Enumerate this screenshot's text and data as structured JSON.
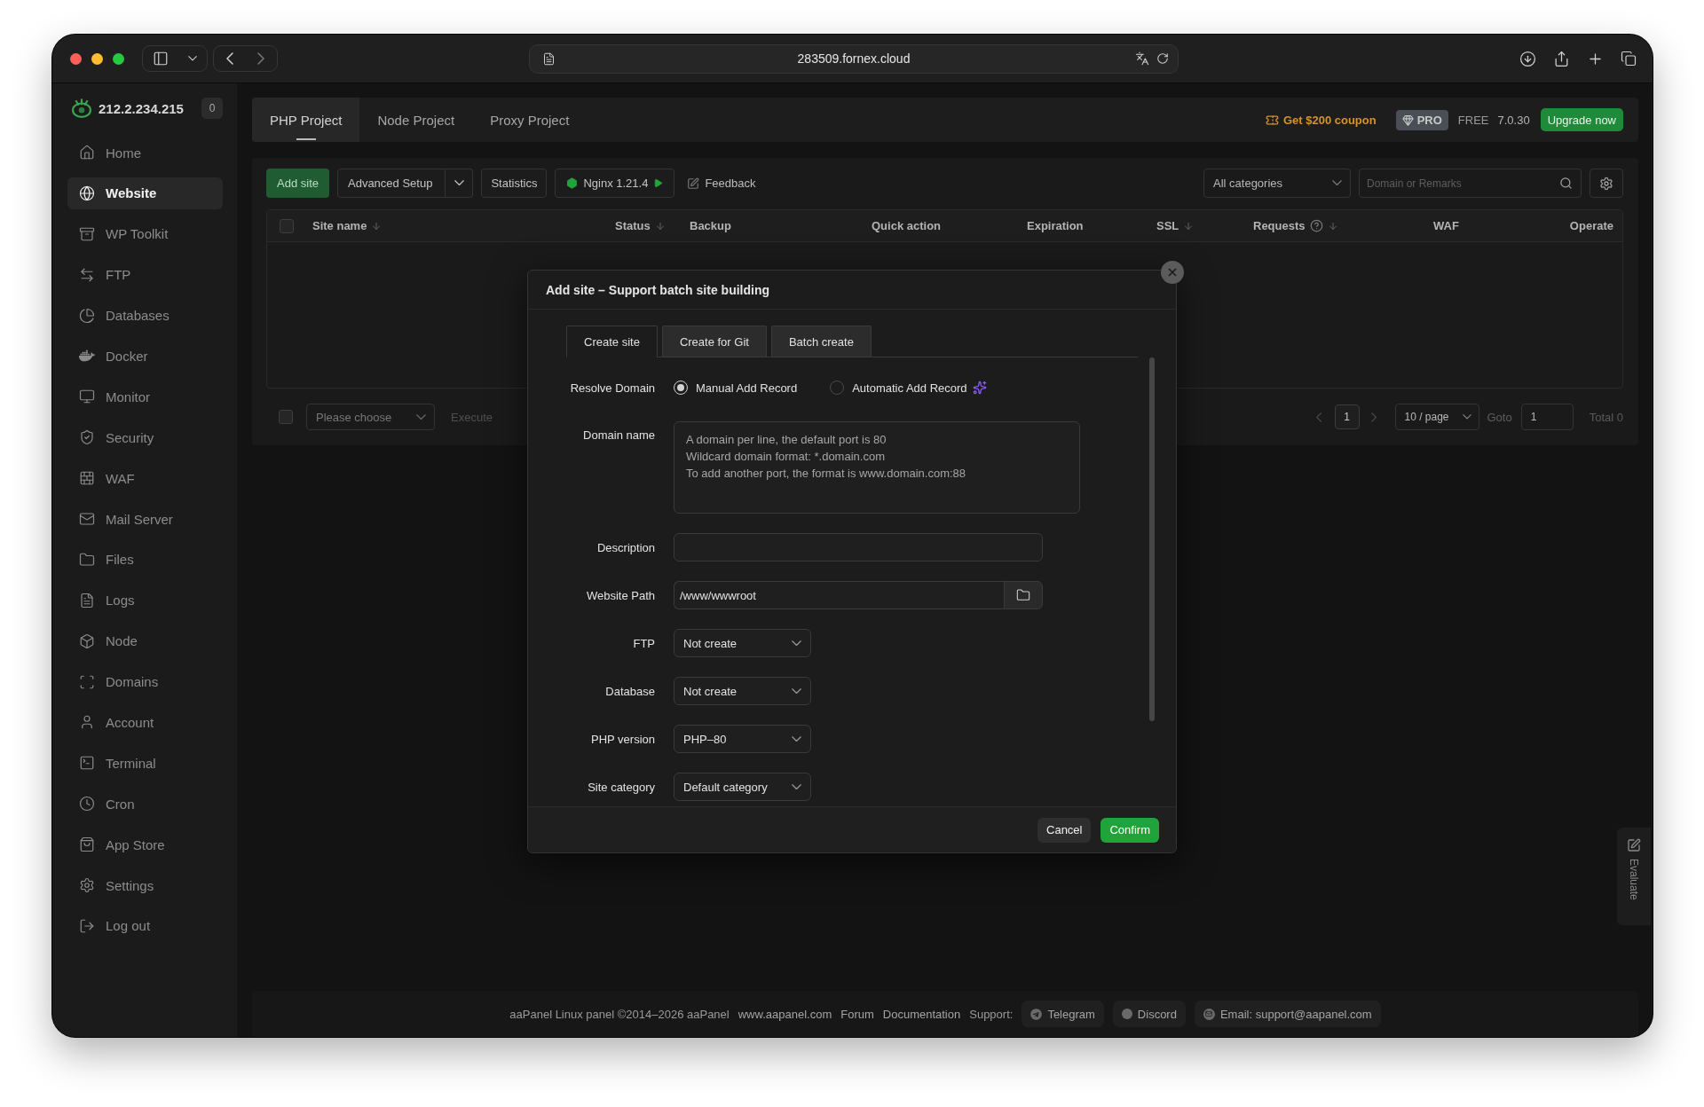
{
  "browser": {
    "url": "283509.fornex.cloud"
  },
  "sidebar": {
    "server": "212.2.234.215",
    "badge": "0",
    "items": [
      {
        "label": "Home",
        "selected": false
      },
      {
        "label": "Website",
        "selected": true
      },
      {
        "label": "WP Toolkit",
        "selected": false
      },
      {
        "label": "FTP",
        "selected": false
      },
      {
        "label": "Databases",
        "selected": false
      },
      {
        "label": "Docker",
        "selected": false
      },
      {
        "label": "Monitor",
        "selected": false
      },
      {
        "label": "Security",
        "selected": false
      },
      {
        "label": "WAF",
        "selected": false
      },
      {
        "label": "Mail Server",
        "selected": false
      },
      {
        "label": "Files",
        "selected": false
      },
      {
        "label": "Logs",
        "selected": false
      },
      {
        "label": "Node",
        "selected": false
      },
      {
        "label": "Domains",
        "selected": false
      },
      {
        "label": "Account",
        "selected": false
      },
      {
        "label": "Terminal",
        "selected": false
      },
      {
        "label": "Cron",
        "selected": false
      },
      {
        "label": "App Store",
        "selected": false
      },
      {
        "label": "Settings",
        "selected": false
      },
      {
        "label": "Log out",
        "selected": false
      }
    ]
  },
  "project_tabs": [
    {
      "label": "PHP Project",
      "selected": true
    },
    {
      "label": "Node Project",
      "selected": false
    },
    {
      "label": "Proxy Project",
      "selected": false
    }
  ],
  "header_actions": {
    "coupon": "Get $200 coupon",
    "pro_badge": "PRO",
    "plan": "FREE",
    "version": "7.0.30",
    "upgrade": "Upgrade now"
  },
  "toolbar": {
    "add_site": "Add site",
    "advanced_setup": "Advanced Setup",
    "statistics": "Statistics",
    "nginx": "Nginx 1.21.4",
    "nginx_running": true,
    "feedback": "Feedback",
    "category": "All categories",
    "search_placeholder": "Domain or Remarks"
  },
  "table": {
    "select_all": {
      "checked": false
    },
    "columns": [
      {
        "label": "Site name",
        "sortable": true,
        "help": false
      },
      {
        "label": "Status",
        "sortable": true,
        "help": false
      },
      {
        "label": "Backup",
        "sortable": false,
        "help": false
      },
      {
        "label": "Quick action",
        "sortable": false,
        "help": false
      },
      {
        "label": "Expiration",
        "sortable": false,
        "help": false
      },
      {
        "label": "SSL",
        "sortable": true,
        "help": false
      },
      {
        "label": "Requests",
        "sortable": true,
        "help": true
      },
      {
        "label": "WAF",
        "sortable": false,
        "help": false
      },
      {
        "label": "Operate",
        "sortable": false,
        "help": false
      }
    ]
  },
  "batch": {
    "checked": false,
    "action_placeholder": "Please choose",
    "execute": "Execute",
    "execute_disabled": true
  },
  "pagination": {
    "prev": {
      "disabled": true
    },
    "pages": [
      {
        "label": "1",
        "selected": true
      }
    ],
    "next": {
      "disabled": true
    },
    "page_size": "10 / page",
    "goto_label": "Goto",
    "goto_value": "1",
    "total": "Total 0"
  },
  "dialog": {
    "title": "Add site – Support batch site building",
    "tabs": [
      {
        "label": "Create site",
        "selected": true
      },
      {
        "label": "Create for Git",
        "selected": false
      },
      {
        "label": "Batch create",
        "selected": false
      }
    ],
    "resolve_domain": {
      "label": "Resolve Domain",
      "options": [
        {
          "label": "Manual Add Record",
          "selected": true
        },
        {
          "label": "Automatic Add Record",
          "selected": false
        }
      ]
    },
    "fields": [
      {
        "kind": "textarea",
        "label": "Domain name",
        "placeholder": "A domain per line, the default port is 80\nWildcard domain format: *.domain.com\nTo add another port, the format is www.domain.com:88"
      },
      {
        "kind": "text",
        "label": "Description"
      },
      {
        "kind": "path",
        "label": "Website Path",
        "value": "/www/wwwroot"
      },
      {
        "kind": "select",
        "label": "FTP",
        "value": "Not create"
      },
      {
        "kind": "select",
        "label": "Database",
        "value": "Not create"
      },
      {
        "kind": "select",
        "label": "PHP version",
        "value": "PHP–80"
      },
      {
        "kind": "select",
        "label": "Site category",
        "value": "Default category"
      }
    ],
    "cancel": "Cancel",
    "confirm": "Confirm"
  },
  "footer": {
    "copyright": "aaPanel Linux panel ©2014–2026 aaPanel",
    "links": [
      {
        "label": "www.aapanel.com"
      },
      {
        "label": "Forum"
      },
      {
        "label": "Documentation"
      }
    ],
    "support_label": "Support:",
    "support": [
      {
        "label": "Telegram"
      },
      {
        "label": "Discord"
      },
      {
        "label": "Email: support@aapanel.com"
      }
    ]
  },
  "evaluate": "Evaluate"
}
